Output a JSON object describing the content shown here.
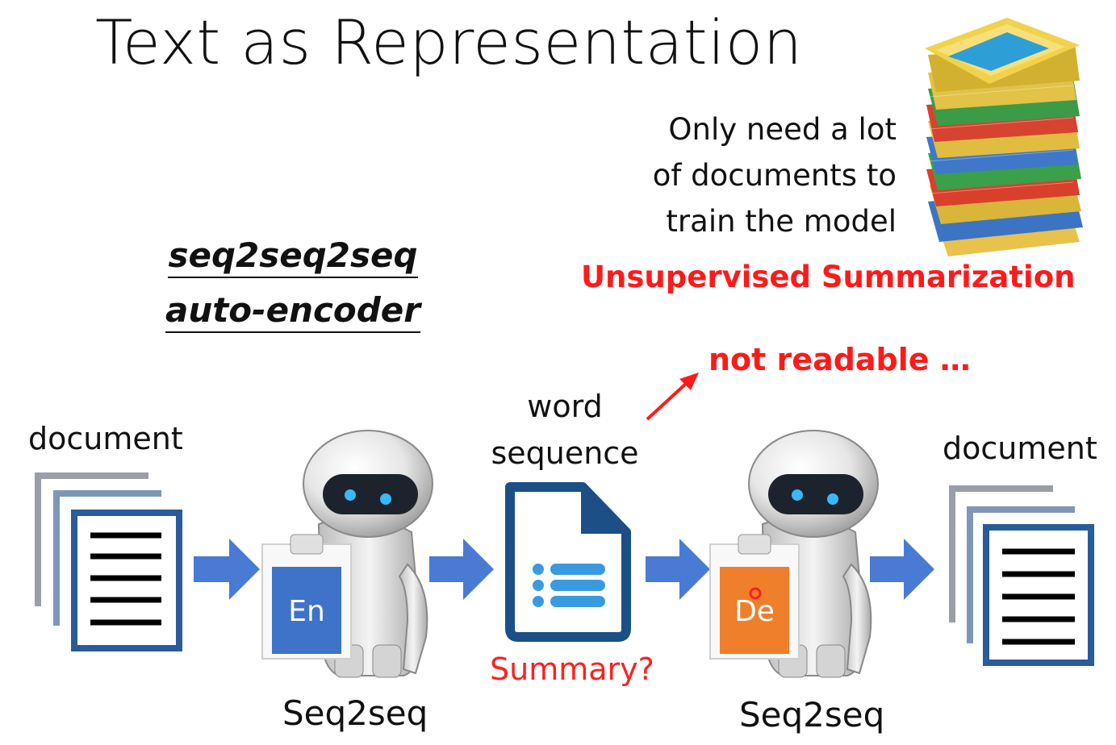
{
  "slide": {
    "title": "Text as Representation",
    "subtitle_lines": [
      "seq2seq2seq",
      "auto-encoder"
    ],
    "note_lines": [
      "Only need a lot",
      "of documents to",
      "train the model"
    ],
    "highlight": "Unsupervised Summarization",
    "annotation": "not readable …"
  },
  "pipeline": {
    "input_label": "document",
    "encoder_badge": "En",
    "encoder_label": "Seq2seq",
    "middle_label_lines": [
      "word",
      "sequence"
    ],
    "middle_question": "Summary?",
    "decoder_badge": "De",
    "decoder_label": "Seq2seq",
    "output_label": "document"
  },
  "colors": {
    "accent_red": "#ff1a1a",
    "arrow_blue": "#4a7bd4",
    "encoder_blue": "#3f73c9",
    "decoder_orange": "#ef7f2a",
    "doc_navy": "#1f4e8c",
    "doc_icon": "#1b4f86",
    "doc_icon_lines": "#3a9ae0"
  },
  "icons": [
    "document-stack-icon",
    "robot-icon",
    "file-list-icon",
    "paper-stack-icon",
    "arrow-right-icon"
  ]
}
